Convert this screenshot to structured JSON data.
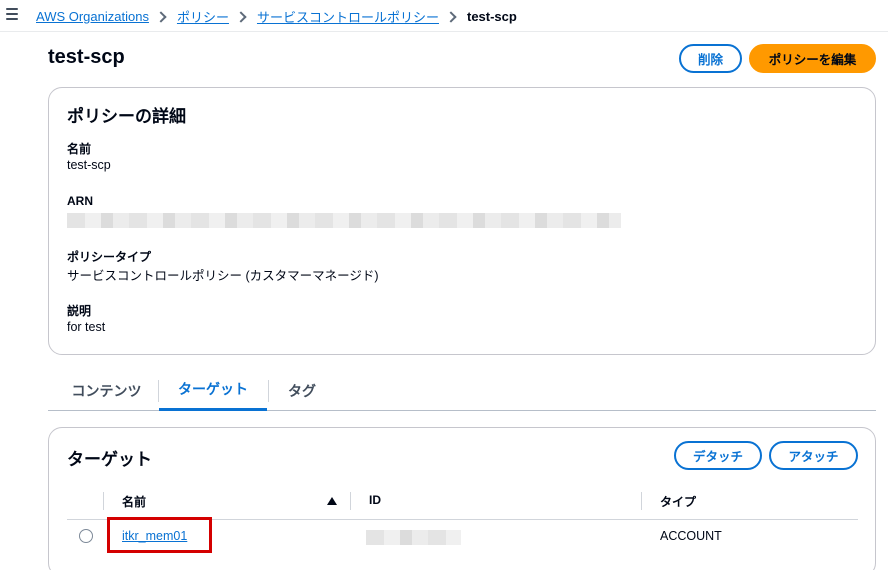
{
  "breadcrumb": {
    "items": [
      "AWS Organizations",
      "ポリシー",
      "サービスコントロールポリシー"
    ],
    "current": "test-scp"
  },
  "header": {
    "title": "test-scp",
    "delete_label": "削除",
    "edit_label": "ポリシーを編集"
  },
  "details": {
    "title": "ポリシーの詳細",
    "name_label": "名前",
    "name_value": "test-scp",
    "arn_label": "ARN",
    "type_label": "ポリシータイプ",
    "type_value": "サービスコントロールポリシー (カスタマーマネージド)",
    "description_label": "説明",
    "description_value": "for test"
  },
  "tabs": [
    {
      "label": "コンテンツ",
      "active": false
    },
    {
      "label": "ターゲット",
      "active": true
    },
    {
      "label": "タグ",
      "active": false
    }
  ],
  "targets": {
    "title": "ターゲット",
    "detach_label": "デタッチ",
    "attach_label": "アタッチ",
    "columns": [
      "名前",
      "ID",
      "タイプ"
    ],
    "rows": [
      {
        "name": "itkr_mem01",
        "type": "ACCOUNT"
      }
    ]
  },
  "colors": {
    "link": "#0972d3",
    "primary": "#ff9900",
    "highlight": "#d40000"
  }
}
